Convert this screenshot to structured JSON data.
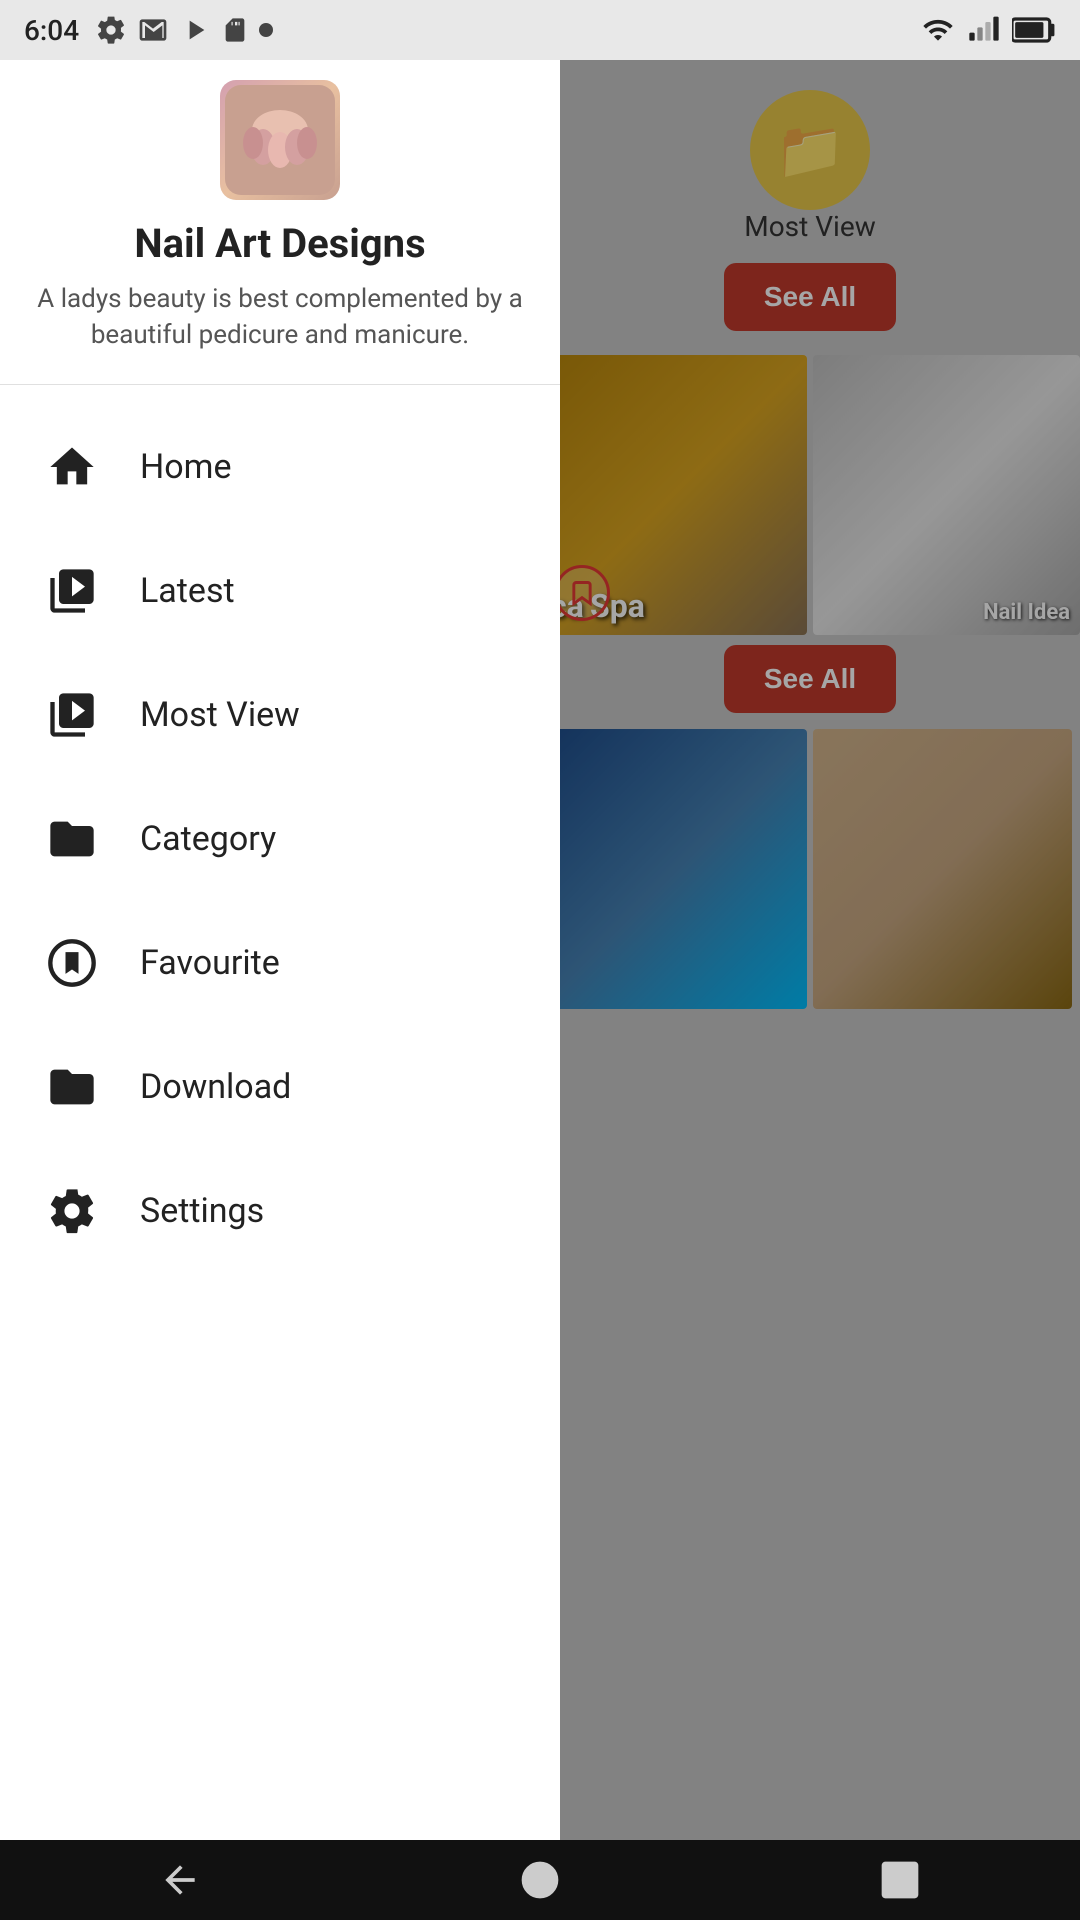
{
  "status_bar": {
    "time": "6:04",
    "icons_left": [
      "gear-icon",
      "gmail-icon",
      "play-icon",
      "sd-card-icon",
      "dot-icon"
    ],
    "icons_right": [
      "wifi-icon",
      "signal-icon",
      "battery-icon"
    ]
  },
  "drawer": {
    "app_logo_alt": "Nail Art Designs logo",
    "app_title": "Nail Art Designs",
    "app_description": "A ladys beauty is best complemented by a beautiful pedicure and manicure.",
    "nav_items": [
      {
        "id": "home",
        "label": "Home",
        "icon": "home-icon"
      },
      {
        "id": "latest",
        "label": "Latest",
        "icon": "latest-icon"
      },
      {
        "id": "most-view",
        "label": "Most View",
        "icon": "most-view-icon"
      },
      {
        "id": "category",
        "label": "Category",
        "icon": "category-icon"
      },
      {
        "id": "favourite",
        "label": "Favourite",
        "icon": "favourite-icon"
      },
      {
        "id": "download",
        "label": "Download",
        "icon": "download-icon"
      },
      {
        "id": "settings",
        "label": "Settings",
        "icon": "settings-icon"
      }
    ]
  },
  "right_panel": {
    "most_view_label": "Most View",
    "see_all_label": "See All",
    "nail_idea_label": "Nail Idea",
    "spa_label": "ca Spa",
    "see_all2_label": "See All"
  },
  "bottom_nav": {
    "back_label": "back",
    "home_label": "home",
    "square_label": "recents"
  }
}
